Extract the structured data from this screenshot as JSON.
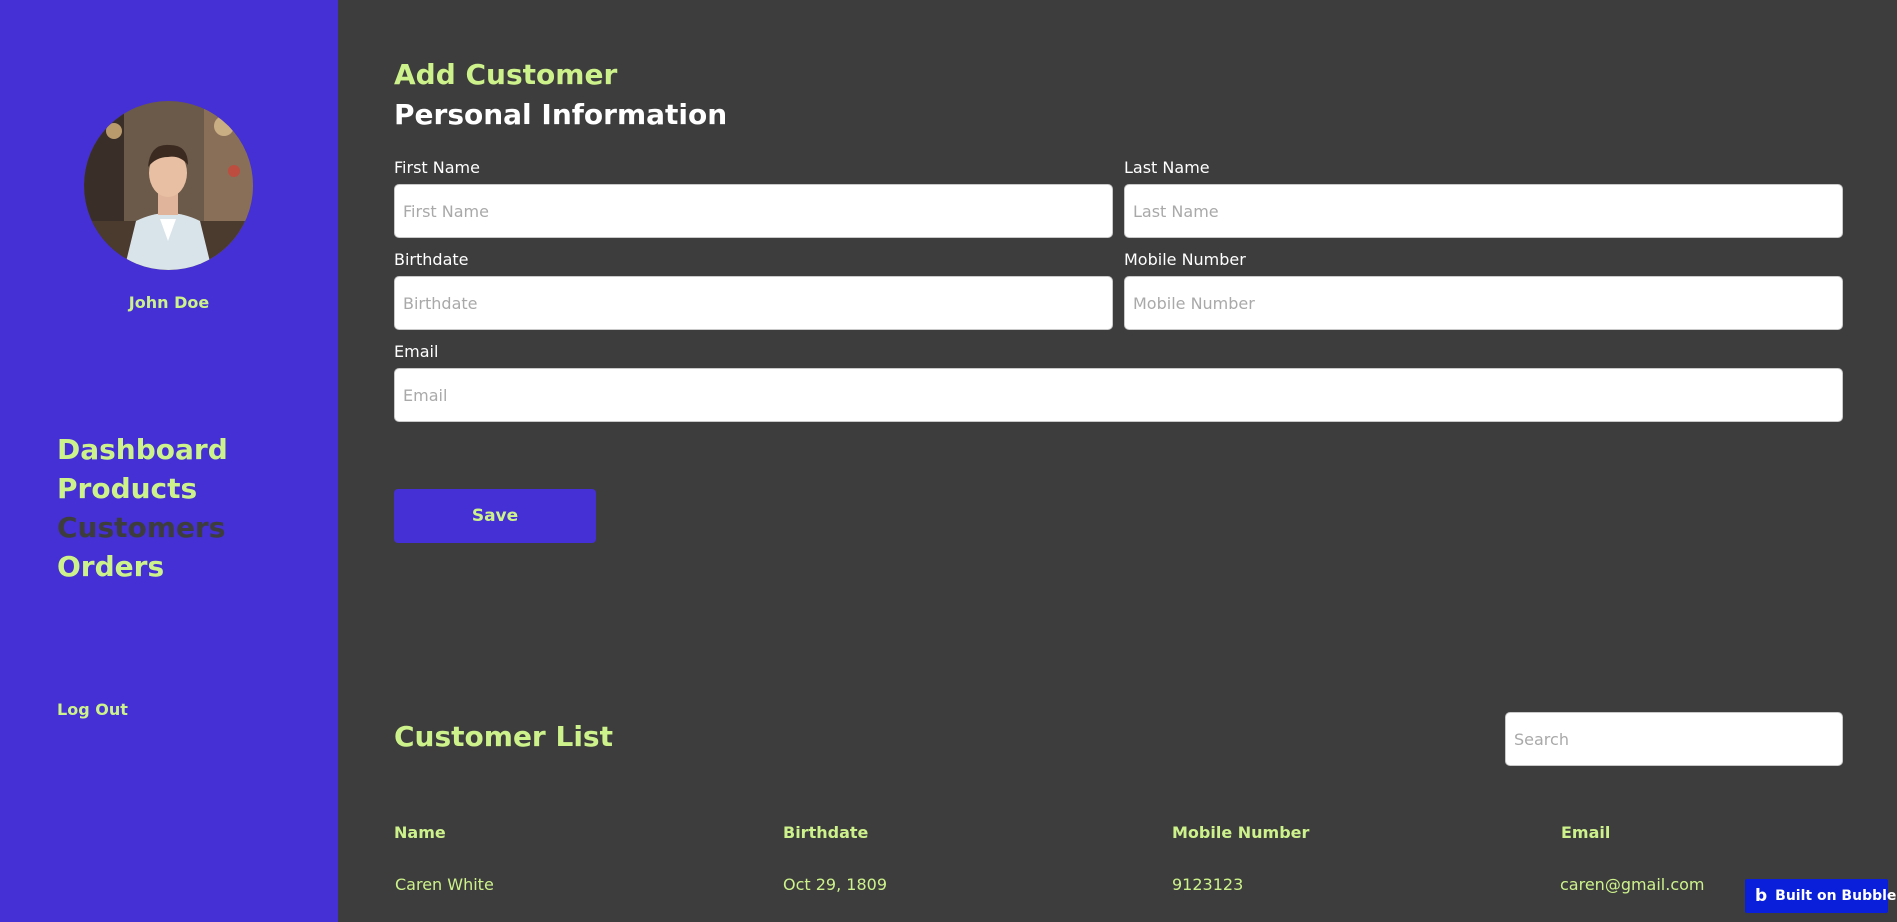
{
  "sidebar": {
    "user_name": "John Doe",
    "nav": [
      {
        "label": "Dashboard",
        "active": false
      },
      {
        "label": "Products",
        "active": false
      },
      {
        "label": "Customers",
        "active": true
      },
      {
        "label": "Orders",
        "active": false
      }
    ],
    "logout_label": "Log Out"
  },
  "form": {
    "title": "Add Customer",
    "section_title": "Personal Information",
    "first_name": {
      "label": "First Name",
      "placeholder": "First Name",
      "value": ""
    },
    "last_name": {
      "label": "Last Name",
      "placeholder": "Last Name",
      "value": ""
    },
    "birthdate": {
      "label": "Birthdate",
      "placeholder": "Birthdate",
      "value": ""
    },
    "mobile": {
      "label": "Mobile Number",
      "placeholder": "Mobile Number",
      "value": ""
    },
    "email": {
      "label": "Email",
      "placeholder": "Email",
      "value": ""
    },
    "save_label": "Save"
  },
  "customer_list": {
    "title": "Customer List",
    "search_placeholder": "Search",
    "columns": [
      "Name",
      "Birthdate",
      "Mobile Number",
      "Email"
    ],
    "rows": [
      [
        "Caren White",
        "Oct 29, 1809",
        "9123123",
        "caren@gmail.com"
      ]
    ]
  },
  "badge": {
    "logo": "b",
    "label": "Built on Bubble"
  },
  "colors": {
    "sidebar_bg": "#4430d4",
    "main_bg": "#3d3d3d",
    "accent_text": "#cdf28b",
    "badge_bg": "#0a1fd9"
  }
}
